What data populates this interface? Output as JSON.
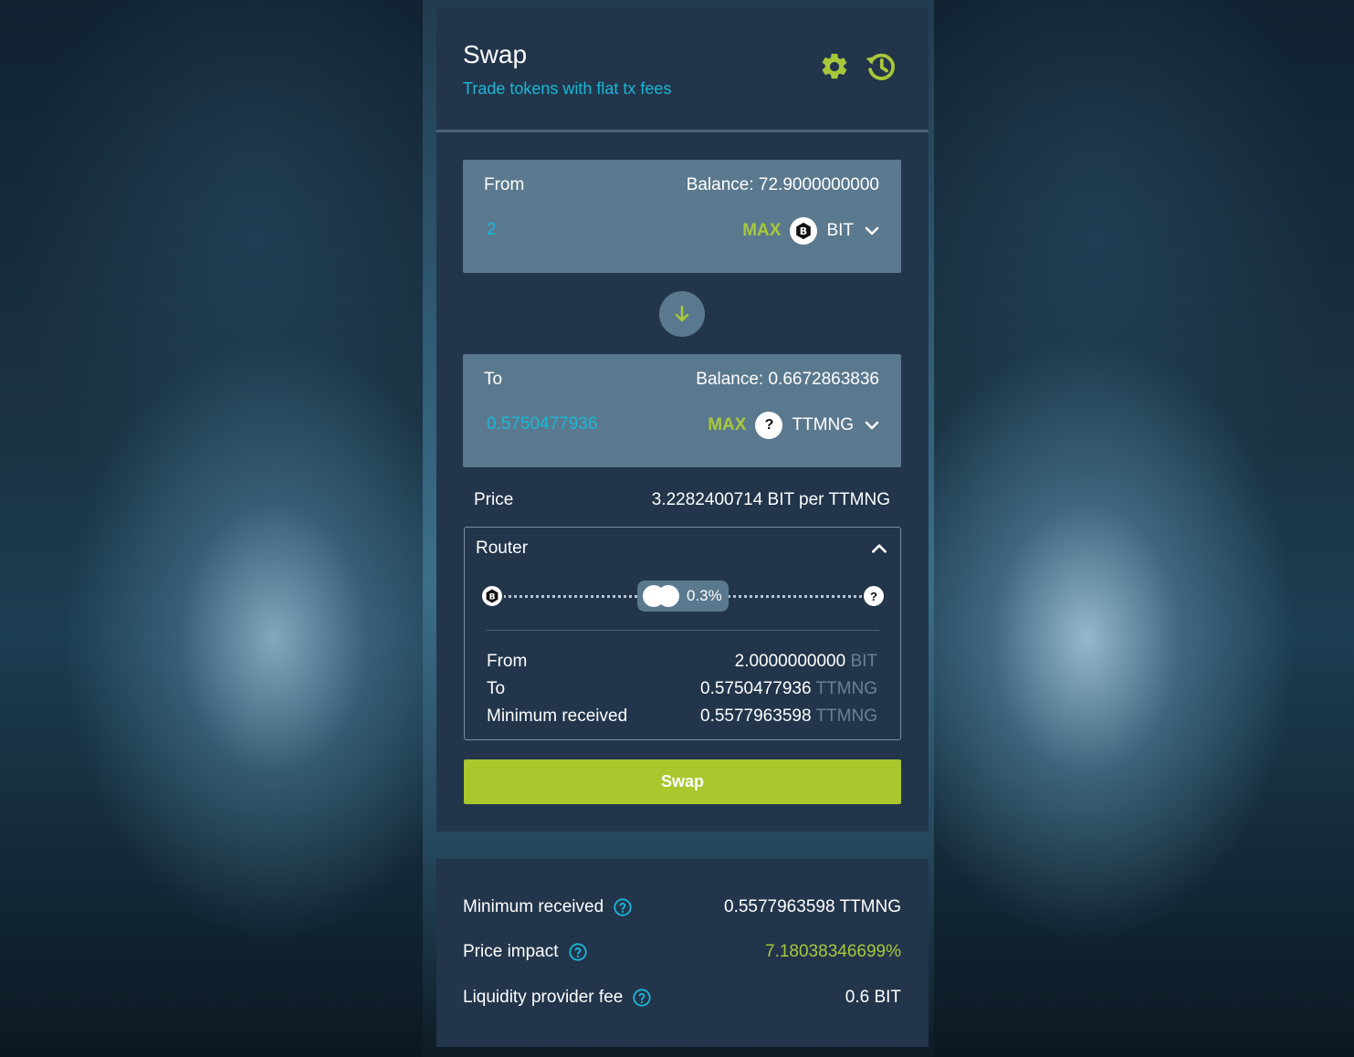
{
  "header": {
    "title": "Swap",
    "subtitle": "Trade tokens with flat tx fees",
    "settings_icon": "gear-icon",
    "history_icon": "history-icon"
  },
  "from": {
    "label": "From",
    "balance": "Balance: 72.9000000000",
    "amount": "2",
    "max_label": "MAX",
    "token": "BIT"
  },
  "to": {
    "label": "To",
    "balance": "Balance: 0.6672863836",
    "amount": "0.5750477936",
    "max_label": "MAX",
    "token": "TTMNG",
    "token_icon_glyph": "?"
  },
  "price": {
    "label": "Price",
    "value": "3.2282400714 BIT per TTMNG"
  },
  "router": {
    "title": "Router",
    "pool_fee": "0.3%",
    "end_glyph": "?",
    "rows": [
      {
        "label": "From",
        "value": "2.0000000000",
        "unit": "BIT"
      },
      {
        "label": "To",
        "value": "0.5750477936",
        "unit": "TTMNG"
      },
      {
        "label": "Minimum received",
        "value": "0.5577963598",
        "unit": "TTMNG"
      }
    ]
  },
  "swap_button": "Swap",
  "info": {
    "min_received": {
      "label": "Minimum received",
      "value": "0.5577963598 TTMNG"
    },
    "price_impact": {
      "label": "Price impact",
      "value": "7.18038346699%"
    },
    "lp_fee": {
      "label": "Liquidity provider fee",
      "value": "0.6 BIT"
    }
  },
  "colors": {
    "accent_cyan": "#1ab7d6",
    "accent_green": "#a8c83a",
    "card": "#22354b",
    "input_box": "#5b798e"
  }
}
